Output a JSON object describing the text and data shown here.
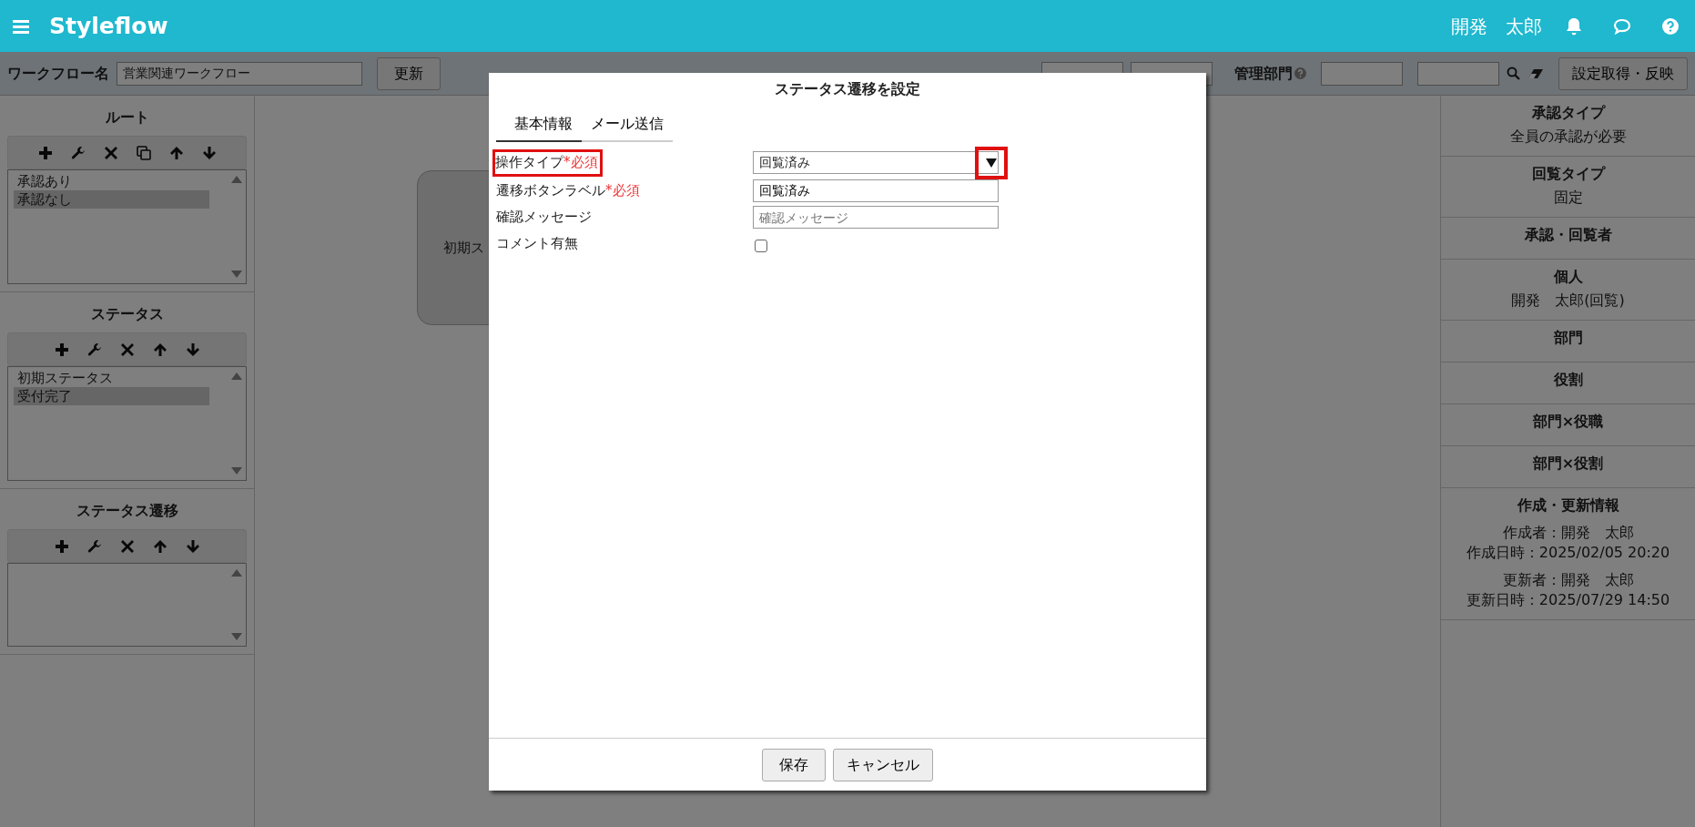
{
  "header": {
    "logo": "Styleflow",
    "user": "開発　太郎"
  },
  "toolbar": {
    "name_label": "ワークフロー名",
    "name_value": "営業関連ワークフロー",
    "update_button": "更新",
    "department_label": "管理部門",
    "apply_button": "設定取得・反映"
  },
  "sidebar": {
    "sections": [
      {
        "title": "ルート",
        "has_copy": true,
        "items": [
          {
            "label": "承認あり",
            "selected": false
          },
          {
            "label": "承認なし",
            "selected": true
          }
        ]
      },
      {
        "title": "ステータス",
        "has_copy": false,
        "items": [
          {
            "label": "初期ステータス",
            "selected": false
          },
          {
            "label": "受付完了",
            "selected": true
          }
        ]
      },
      {
        "title": "ステータス遷移",
        "has_copy": false
      }
    ]
  },
  "canvas": {
    "nodes": [
      {
        "label": "初期ス"
      }
    ]
  },
  "info_panel": {
    "sections": [
      {
        "title": "承認タイプ",
        "lines": [
          "全員の承認が必要"
        ]
      },
      {
        "title": "回覧タイプ",
        "lines": [
          "固定"
        ]
      },
      {
        "title": "承認・回覧者"
      },
      {
        "title": "個人",
        "lines": [
          "開発　太郎(回覧)"
        ]
      },
      {
        "title": "部門"
      },
      {
        "title": "役割"
      },
      {
        "title": "部門×役職"
      },
      {
        "title": "部門×役割"
      },
      {
        "title": "作成・更新情報",
        "groups": [
          [
            "作成者：開発　太郎",
            "作成日時：2025/02/05 20:20"
          ],
          [
            "更新者：開発　太郎",
            "更新日時：2025/07/29 14:50"
          ]
        ]
      }
    ]
  },
  "dialog": {
    "title": "ステータス遷移を設定",
    "tabs": [
      {
        "label": "基本情報",
        "selected": true
      },
      {
        "label": "メール送信",
        "selected": false
      }
    ],
    "fields": [
      {
        "kind": "select",
        "label": "操作タイプ",
        "required_mark": "*必須",
        "value": "回覧済み",
        "highlighted": true
      },
      {
        "kind": "text",
        "label": "遷移ボタンラベル",
        "required_mark": "*必須",
        "value": "回覧済み",
        "highlighted": false
      },
      {
        "kind": "text",
        "label": "確認メッセージ",
        "placeholder": "確認メッセージ",
        "highlighted": false
      },
      {
        "kind": "checkbox",
        "label": "コメント有無",
        "checked": false,
        "highlighted": false
      }
    ],
    "buttons": [
      "保存",
      "キャンセル"
    ]
  }
}
